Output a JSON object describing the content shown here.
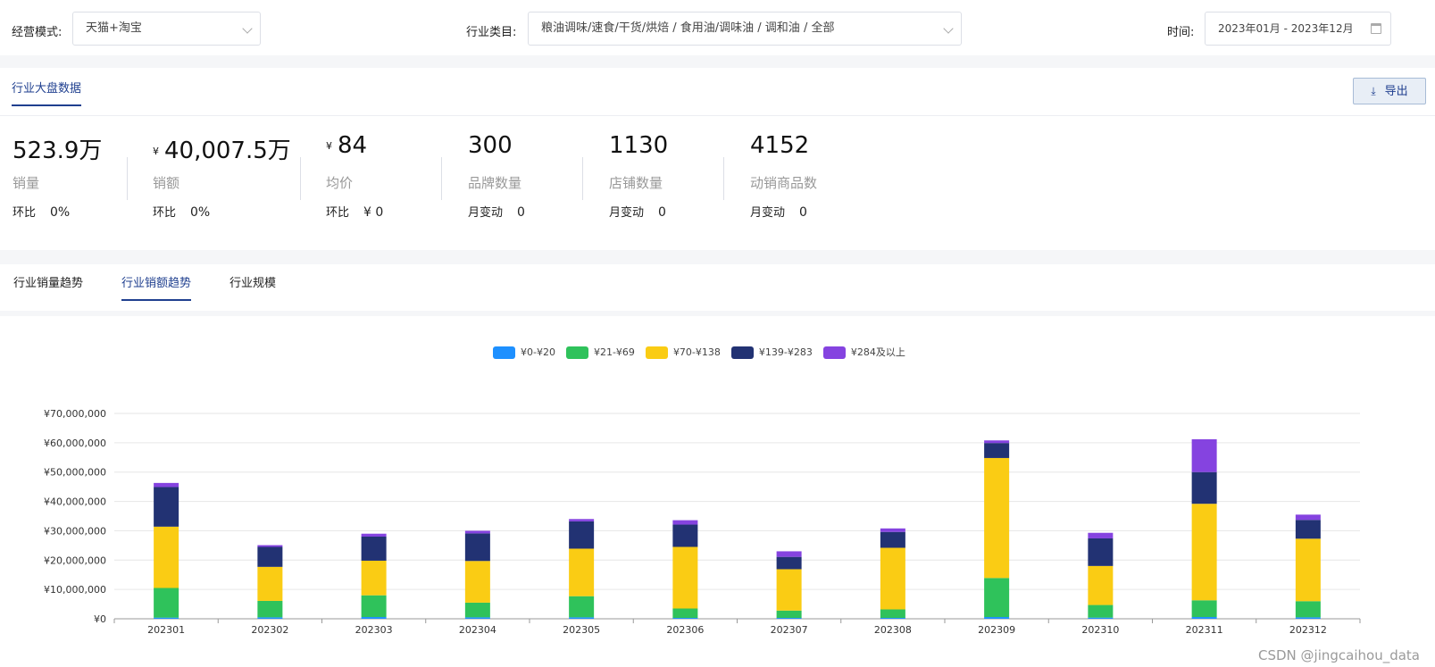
{
  "filters": {
    "mode_label": "经营模式:",
    "mode_value": "天猫+淘宝",
    "category_label": "行业类目:",
    "category_value": "粮油调味/速食/干货/烘焙 / 食用油/调味油 / 调和油 / 全部",
    "time_label": "时间:",
    "time_value": "2023年01月 - 2023年12月"
  },
  "overview": {
    "tab": "行业大盘数据",
    "export_label": "导出",
    "metrics": [
      {
        "value": "523.9万",
        "currency": "",
        "name": "销量",
        "change_label": "环比",
        "change_value": "0%"
      },
      {
        "value": "40,007.5万",
        "currency": "¥",
        "name": "销额",
        "change_label": "环比",
        "change_value": "0%"
      },
      {
        "value": "84",
        "currency": "¥",
        "name": "均价",
        "change_label": "环比",
        "change_value": "¥ 0"
      },
      {
        "value": "300",
        "currency": "",
        "name": "品牌数量",
        "change_label": "月变动",
        "change_value": "0"
      },
      {
        "value": "1130",
        "currency": "",
        "name": "店铺数量",
        "change_label": "月变动",
        "change_value": "0"
      },
      {
        "value": "4152",
        "currency": "",
        "name": "动销商品数",
        "change_label": "月变动",
        "change_value": "0"
      }
    ]
  },
  "trend_tabs": [
    {
      "label": "行业销量趋势",
      "active": false
    },
    {
      "label": "行业销额趋势",
      "active": true
    },
    {
      "label": "行业规模",
      "active": false
    }
  ],
  "watermark": "CSDN @jingcaihou_data",
  "chart_data": {
    "type": "bar",
    "stacked": true,
    "categories": [
      "202301",
      "202302",
      "202303",
      "202304",
      "202305",
      "202306",
      "202307",
      "202308",
      "202309",
      "202310",
      "202311",
      "202312"
    ],
    "series": [
      {
        "name": "¥0-¥20",
        "color": "#1e90ff",
        "values": [
          400000,
          500000,
          600000,
          500000,
          500000,
          300000,
          300000,
          300000,
          600000,
          400000,
          600000,
          500000
        ]
      },
      {
        "name": "¥21-¥69",
        "color": "#2fc25b",
        "values": [
          10100000,
          5600000,
          7400000,
          5000000,
          7200000,
          3200000,
          2500000,
          2900000,
          13300000,
          4300000,
          5700000,
          5500000
        ]
      },
      {
        "name": "¥70-¥138",
        "color": "#facc14",
        "values": [
          20900000,
          11600000,
          11800000,
          14200000,
          16200000,
          21000000,
          14100000,
          21000000,
          40900000,
          13300000,
          32900000,
          21300000
        ]
      },
      {
        "name": "¥139-¥283",
        "color": "#223273",
        "values": [
          13500000,
          6800000,
          8200000,
          9400000,
          9300000,
          7600000,
          4200000,
          5400000,
          5100000,
          9400000,
          10800000,
          6400000
        ]
      },
      {
        "name": "¥284及以上",
        "color": "#8543e0",
        "values": [
          1400000,
          600000,
          1000000,
          900000,
          800000,
          1500000,
          1900000,
          1200000,
          900000,
          1900000,
          11200000,
          1800000
        ]
      }
    ],
    "ylim": [
      0,
      70000000
    ],
    "yticks": [
      0,
      10000000,
      20000000,
      30000000,
      40000000,
      50000000,
      60000000,
      70000000
    ],
    "ytick_labels": [
      "¥0",
      "¥10,000,000",
      "¥20,000,000",
      "¥30,000,000",
      "¥40,000,000",
      "¥50,000,000",
      "¥60,000,000",
      "¥70,000,000"
    ],
    "legend": "top-center",
    "grid": true
  }
}
